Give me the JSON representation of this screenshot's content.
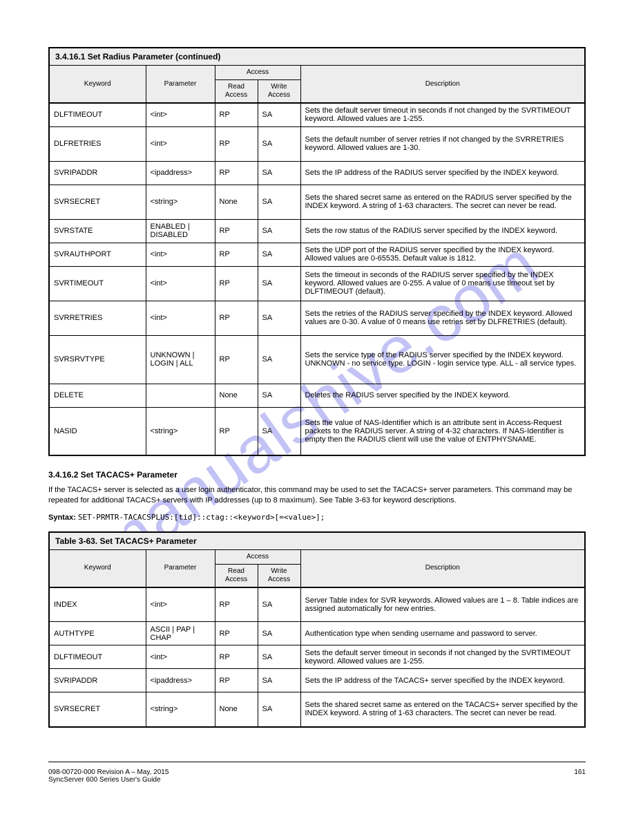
{
  "watermark": "manualshive.com",
  "section_title": "3.4.16.2  Set TACACS+ Parameter",
  "table1": {
    "title": "3.4.16.1  Set Radius Parameter (continued)",
    "headers": {
      "keyword": "Keyword",
      "parameter": "Parameter",
      "access": "Access",
      "read": "Read Access",
      "write": "Write Access",
      "description": "Description"
    },
    "rows": [
      {
        "k": "DLFTIMEOUT",
        "p": "<int>",
        "r": "RP",
        "w": "SA",
        "d": "Sets the default server timeout in seconds if not changed by the SVRTIMEOUT keyword. Allowed values are 1-255."
      },
      {
        "k": "DLFRETRIES",
        "p": "<int>",
        "r": "RP",
        "w": "SA",
        "d": "Sets the default number of server retries if not changed by the SVRRETRIES keyword. Allowed values are 1-30."
      },
      {
        "k": "SVRIPADDR",
        "p": "<ipaddress>",
        "r": "RP",
        "w": "SA",
        "d": "Sets the IP address of the RADIUS server specified by the INDEX keyword."
      },
      {
        "k": "SVRSECRET",
        "p": "<string>",
        "r": "None",
        "w": "SA",
        "d": "Sets the shared secret same as entered on the RADIUS server specified by the INDEX keyword. A string of 1-63 characters. The secret can never be read."
      },
      {
        "k": "SVRSTATE",
        "p": "ENABLED | DISABLED",
        "r": "RP",
        "w": "SA",
        "d": "Sets the row status of the RADIUS server specified by the INDEX keyword."
      },
      {
        "k": "SVRAUTHPORT",
        "p": "<int>",
        "r": "RP",
        "w": "SA",
        "d": "Sets the UDP port of the RADIUS server specified by the INDEX keyword. Allowed values are 0-65535. Default value is 1812."
      },
      {
        "k": "SVRTIMEOUT",
        "p": "<int>",
        "r": "RP",
        "w": "SA",
        "d": "Sets the timeout in seconds of the RADIUS server specified by the INDEX keyword. Allowed values are 0-255. A value of 0 means use timeout set by DLFTIMEOUT (default)."
      },
      {
        "k": "SVRRETRIES",
        "p": "<int>",
        "r": "RP",
        "w": "SA",
        "d": "Sets the retries of the RADIUS server specified by the INDEX keyword. Allowed values are 0-30. A value of 0 means use retries set by DLFRETRIES (default)."
      },
      {
        "k": "SVRSRVTYPE",
        "p": "UNKNOWN | LOGIN | ALL",
        "r": "RP",
        "w": "SA",
        "d": "Sets the service type of the RADIUS server specified by the INDEX keyword. UNKNOWN - no service type. LOGIN - login service type. ALL - all service types."
      },
      {
        "k": "DELETE",
        "p": "",
        "r": "None",
        "w": "SA",
        "d": "Deletes the RADIUS server specified by the INDEX keyword."
      },
      {
        "k": "NASID",
        "p": "<string>",
        "r": "RP",
        "w": "SA",
        "d": "Sets the value of NAS-Identifier which is an attribute sent in Access-Request packets to the RADIUS server. A string of 4-32 characters. If NAS-Identifier is empty then the RADIUS client will use the value of ENTPHYSNAME."
      }
    ]
  },
  "paragraph": "If the TACACS+ server is selected as a user login authenticator, this command may be used to set the TACACS+ server parameters. This command may be repeated for additional TACACS+ servers with IP addresses (up to 8 maximum). See Table 3-63 for keyword descriptions.",
  "syntax_label": "Syntax:",
  "syntax": "SET-PRMTR-TACACSPLUS:[tid]::ctag::<keyword>[=<value>];",
  "table2": {
    "title": "Table 3-63. Set TACACS+ Parameter",
    "headers": {
      "keyword": "Keyword",
      "parameter": "Parameter",
      "access": "Access",
      "read": "Read Access",
      "write": "Write Access",
      "description": "Description"
    },
    "rows": [
      {
        "k": "INDEX",
        "p": "<int>",
        "r": "RP",
        "w": "SA",
        "d": "Server Table index for SVR keywords. Allowed values are 1 – 8. Table indices are assigned automatically for new entries."
      },
      {
        "k": "AUTHTYPE",
        "p": "ASCII | PAP | CHAP",
        "r": "RP",
        "w": "SA",
        "d": "Authentication type when sending username and password to server."
      },
      {
        "k": "DLFTIMEOUT",
        "p": "<int>",
        "r": "RP",
        "w": "SA",
        "d": "Sets the default server timeout in seconds if not changed by the SVRTIMEOUT keyword. Allowed values are 1-255."
      },
      {
        "k": "SVRIPADDR",
        "p": "<ipaddress>",
        "r": "RP",
        "w": "SA",
        "d": "Sets the IP address of the TACACS+ server specified by the INDEX keyword."
      },
      {
        "k": "SVRSECRET",
        "p": "<string>",
        "r": "None",
        "w": "SA",
        "d": "Sets the shared secret same as entered on the TACACS+ server specified by the INDEX keyword. A string of 1-63 characters. The secret can never be read."
      }
    ]
  },
  "footer": {
    "left": "098-00720-000 Revision A – May, 2015",
    "right": "161",
    "sub": "SyncServer 600 Series User's Guide"
  }
}
